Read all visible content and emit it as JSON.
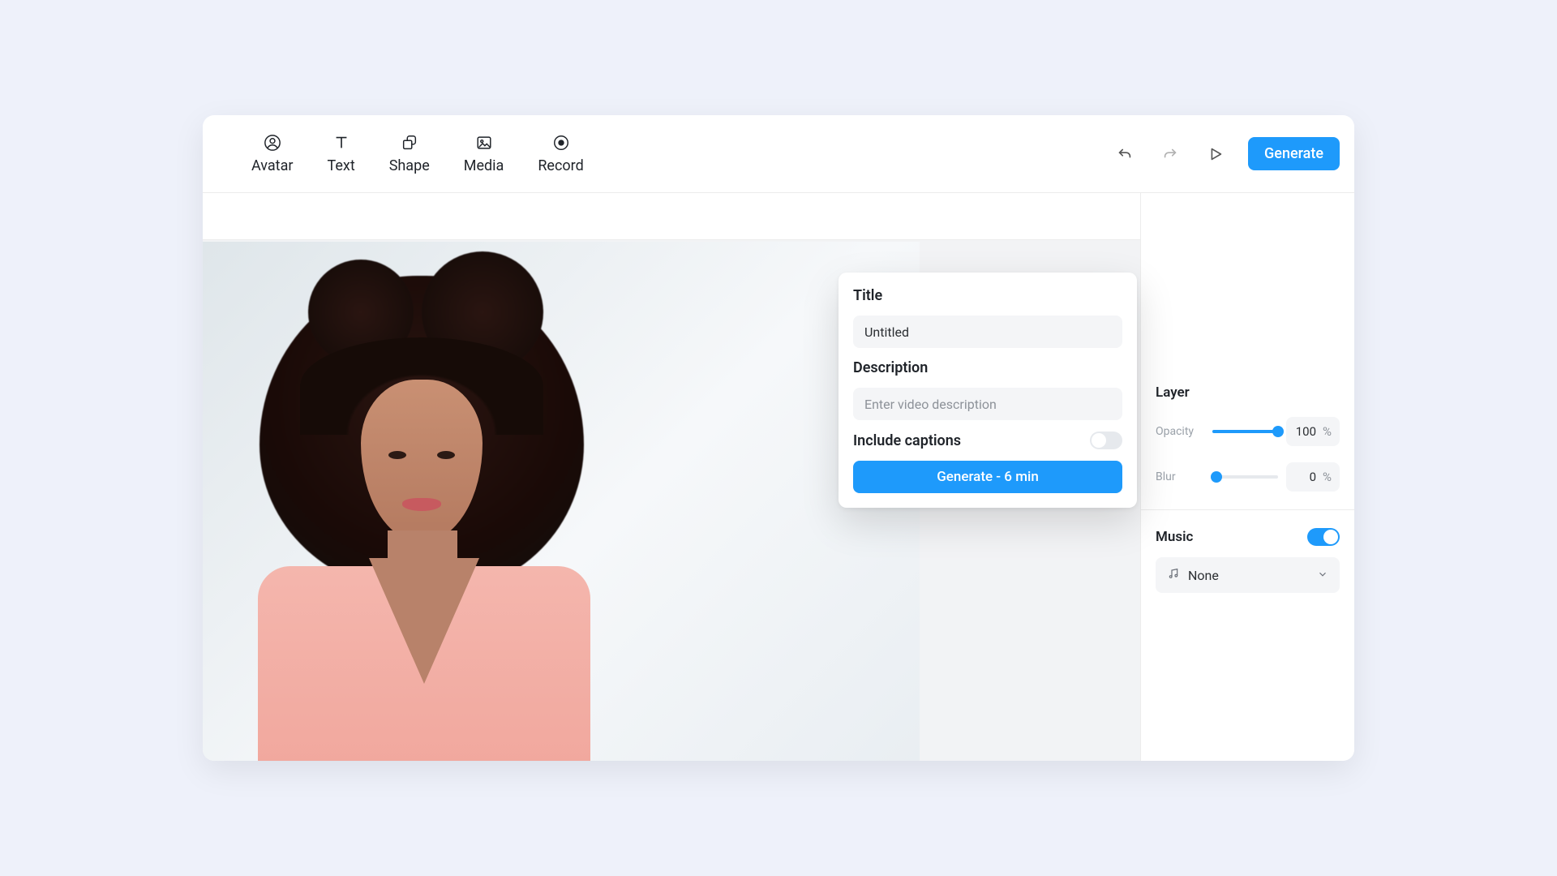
{
  "toolbar": {
    "avatar": "Avatar",
    "text": "Text",
    "shape": "Shape",
    "media": "Media",
    "record": "Record",
    "generate": "Generate"
  },
  "popup": {
    "title_label": "Title",
    "title_value": "Untitled",
    "description_label": "Description",
    "description_placeholder": "Enter video description",
    "captions_label": "Include captions",
    "captions_on": false,
    "generate_label": "Generate - 6 min"
  },
  "panel": {
    "layer_label": "Layer",
    "opacity_label": "Opacity",
    "opacity_value": "100",
    "opacity_unit": "%",
    "opacity_pct": 100,
    "blur_label": "Blur",
    "blur_value": "0",
    "blur_unit": "%",
    "blur_pct": 0,
    "music_label": "Music",
    "music_on": true,
    "music_selected": "None"
  }
}
